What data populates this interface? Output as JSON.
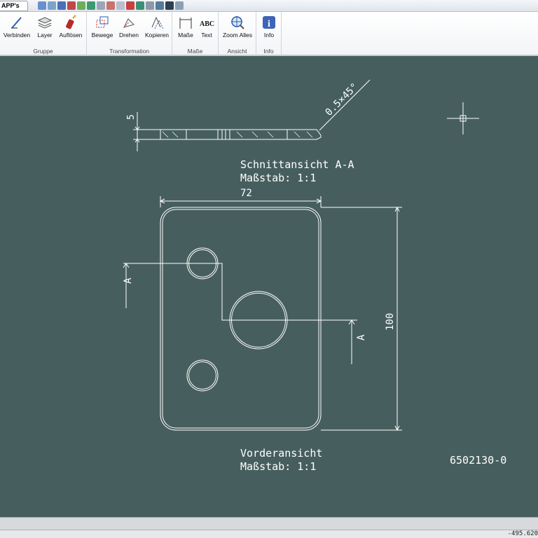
{
  "app_tab": "APP's",
  "ribbon": {
    "groups": {
      "gruppe": {
        "title": "Gruppe",
        "verbinden": "Verbinden",
        "layer": "Layer",
        "aufloesen": "Auflösen"
      },
      "transformation": {
        "title": "Transformation",
        "bewege": "Bewege",
        "drehen": "Drehen",
        "kopieren": "Kopieren"
      },
      "masse": {
        "title": "Maße",
        "masse_btn": "Maße",
        "text": "Text",
        "abc_icon_label": "ABC"
      },
      "ansicht": {
        "title": "Ansicht",
        "zoom_alles": "Zoom Alles"
      },
      "info": {
        "title": "Info",
        "info_btn": "Info",
        "info_icon_letter": "i"
      }
    }
  },
  "drawing": {
    "section_title": "Schnittansicht A-A",
    "section_scale": "Maßstab:  1:1",
    "front_title": "Vorderansicht",
    "front_scale": "Maßstab:  1:1",
    "part_number": "6502130-0",
    "dim_thickness": "5",
    "dim_chamfer": "0.5×45°",
    "dim_width": "72",
    "dim_height": "100",
    "cut_label_left": "A",
    "cut_label_right": "A"
  },
  "status": {
    "coordinates": "-495.620"
  },
  "colors": {
    "canvas_bg": "#465f5e",
    "line": "#ffffff"
  }
}
